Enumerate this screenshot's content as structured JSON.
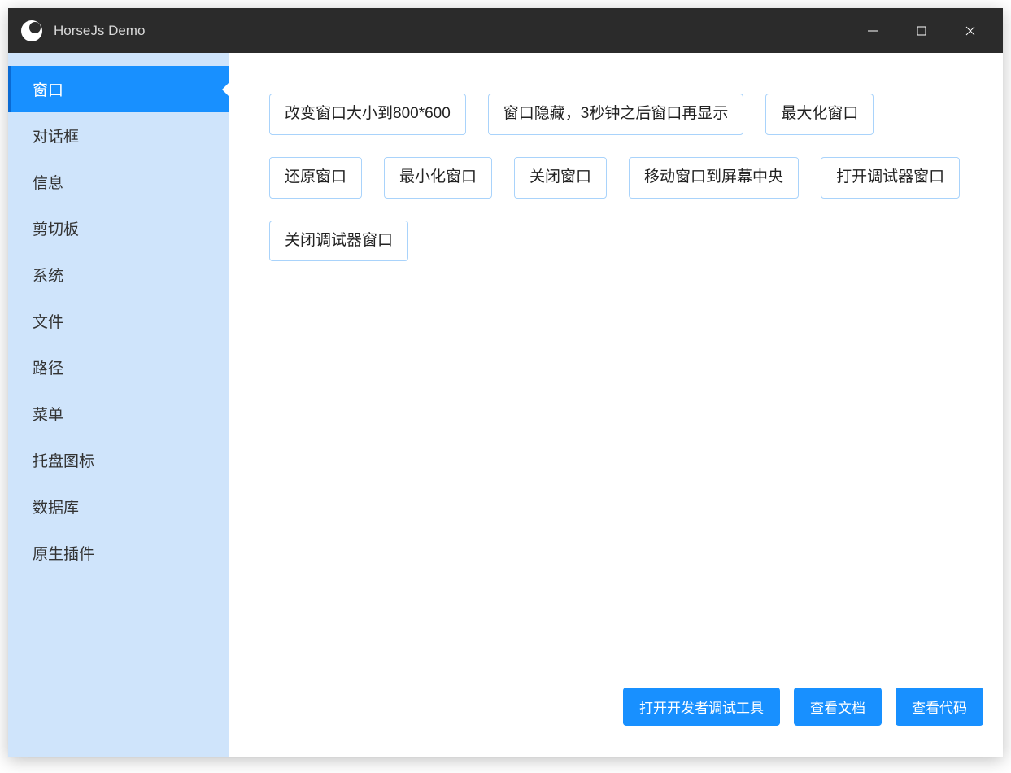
{
  "window": {
    "title": "HorseJs Demo"
  },
  "sidebar": {
    "items": [
      {
        "label": "窗口",
        "active": true
      },
      {
        "label": "对话框",
        "active": false
      },
      {
        "label": "信息",
        "active": false
      },
      {
        "label": "剪切板",
        "active": false
      },
      {
        "label": "系统",
        "active": false
      },
      {
        "label": "文件",
        "active": false
      },
      {
        "label": "路径",
        "active": false
      },
      {
        "label": "菜单",
        "active": false
      },
      {
        "label": "托盘图标",
        "active": false
      },
      {
        "label": "数据库",
        "active": false
      },
      {
        "label": "原生插件",
        "active": false
      }
    ]
  },
  "actions": [
    "改变窗口大小到800*600",
    "窗口隐藏，3秒钟之后窗口再显示",
    "最大化窗口",
    "还原窗口",
    "最小化窗口",
    "关闭窗口",
    "移动窗口到屏幕中央",
    "打开调试器窗口",
    "关闭调试器窗口"
  ],
  "footer": {
    "devtools": "打开开发者调试工具",
    "docs": "查看文档",
    "code": "查看代码"
  },
  "colors": {
    "accent": "#1890ff",
    "sidebar_bg": "#cfe4fb",
    "titlebar_bg": "#2b2b2b",
    "button_border": "#a9d3fb"
  }
}
